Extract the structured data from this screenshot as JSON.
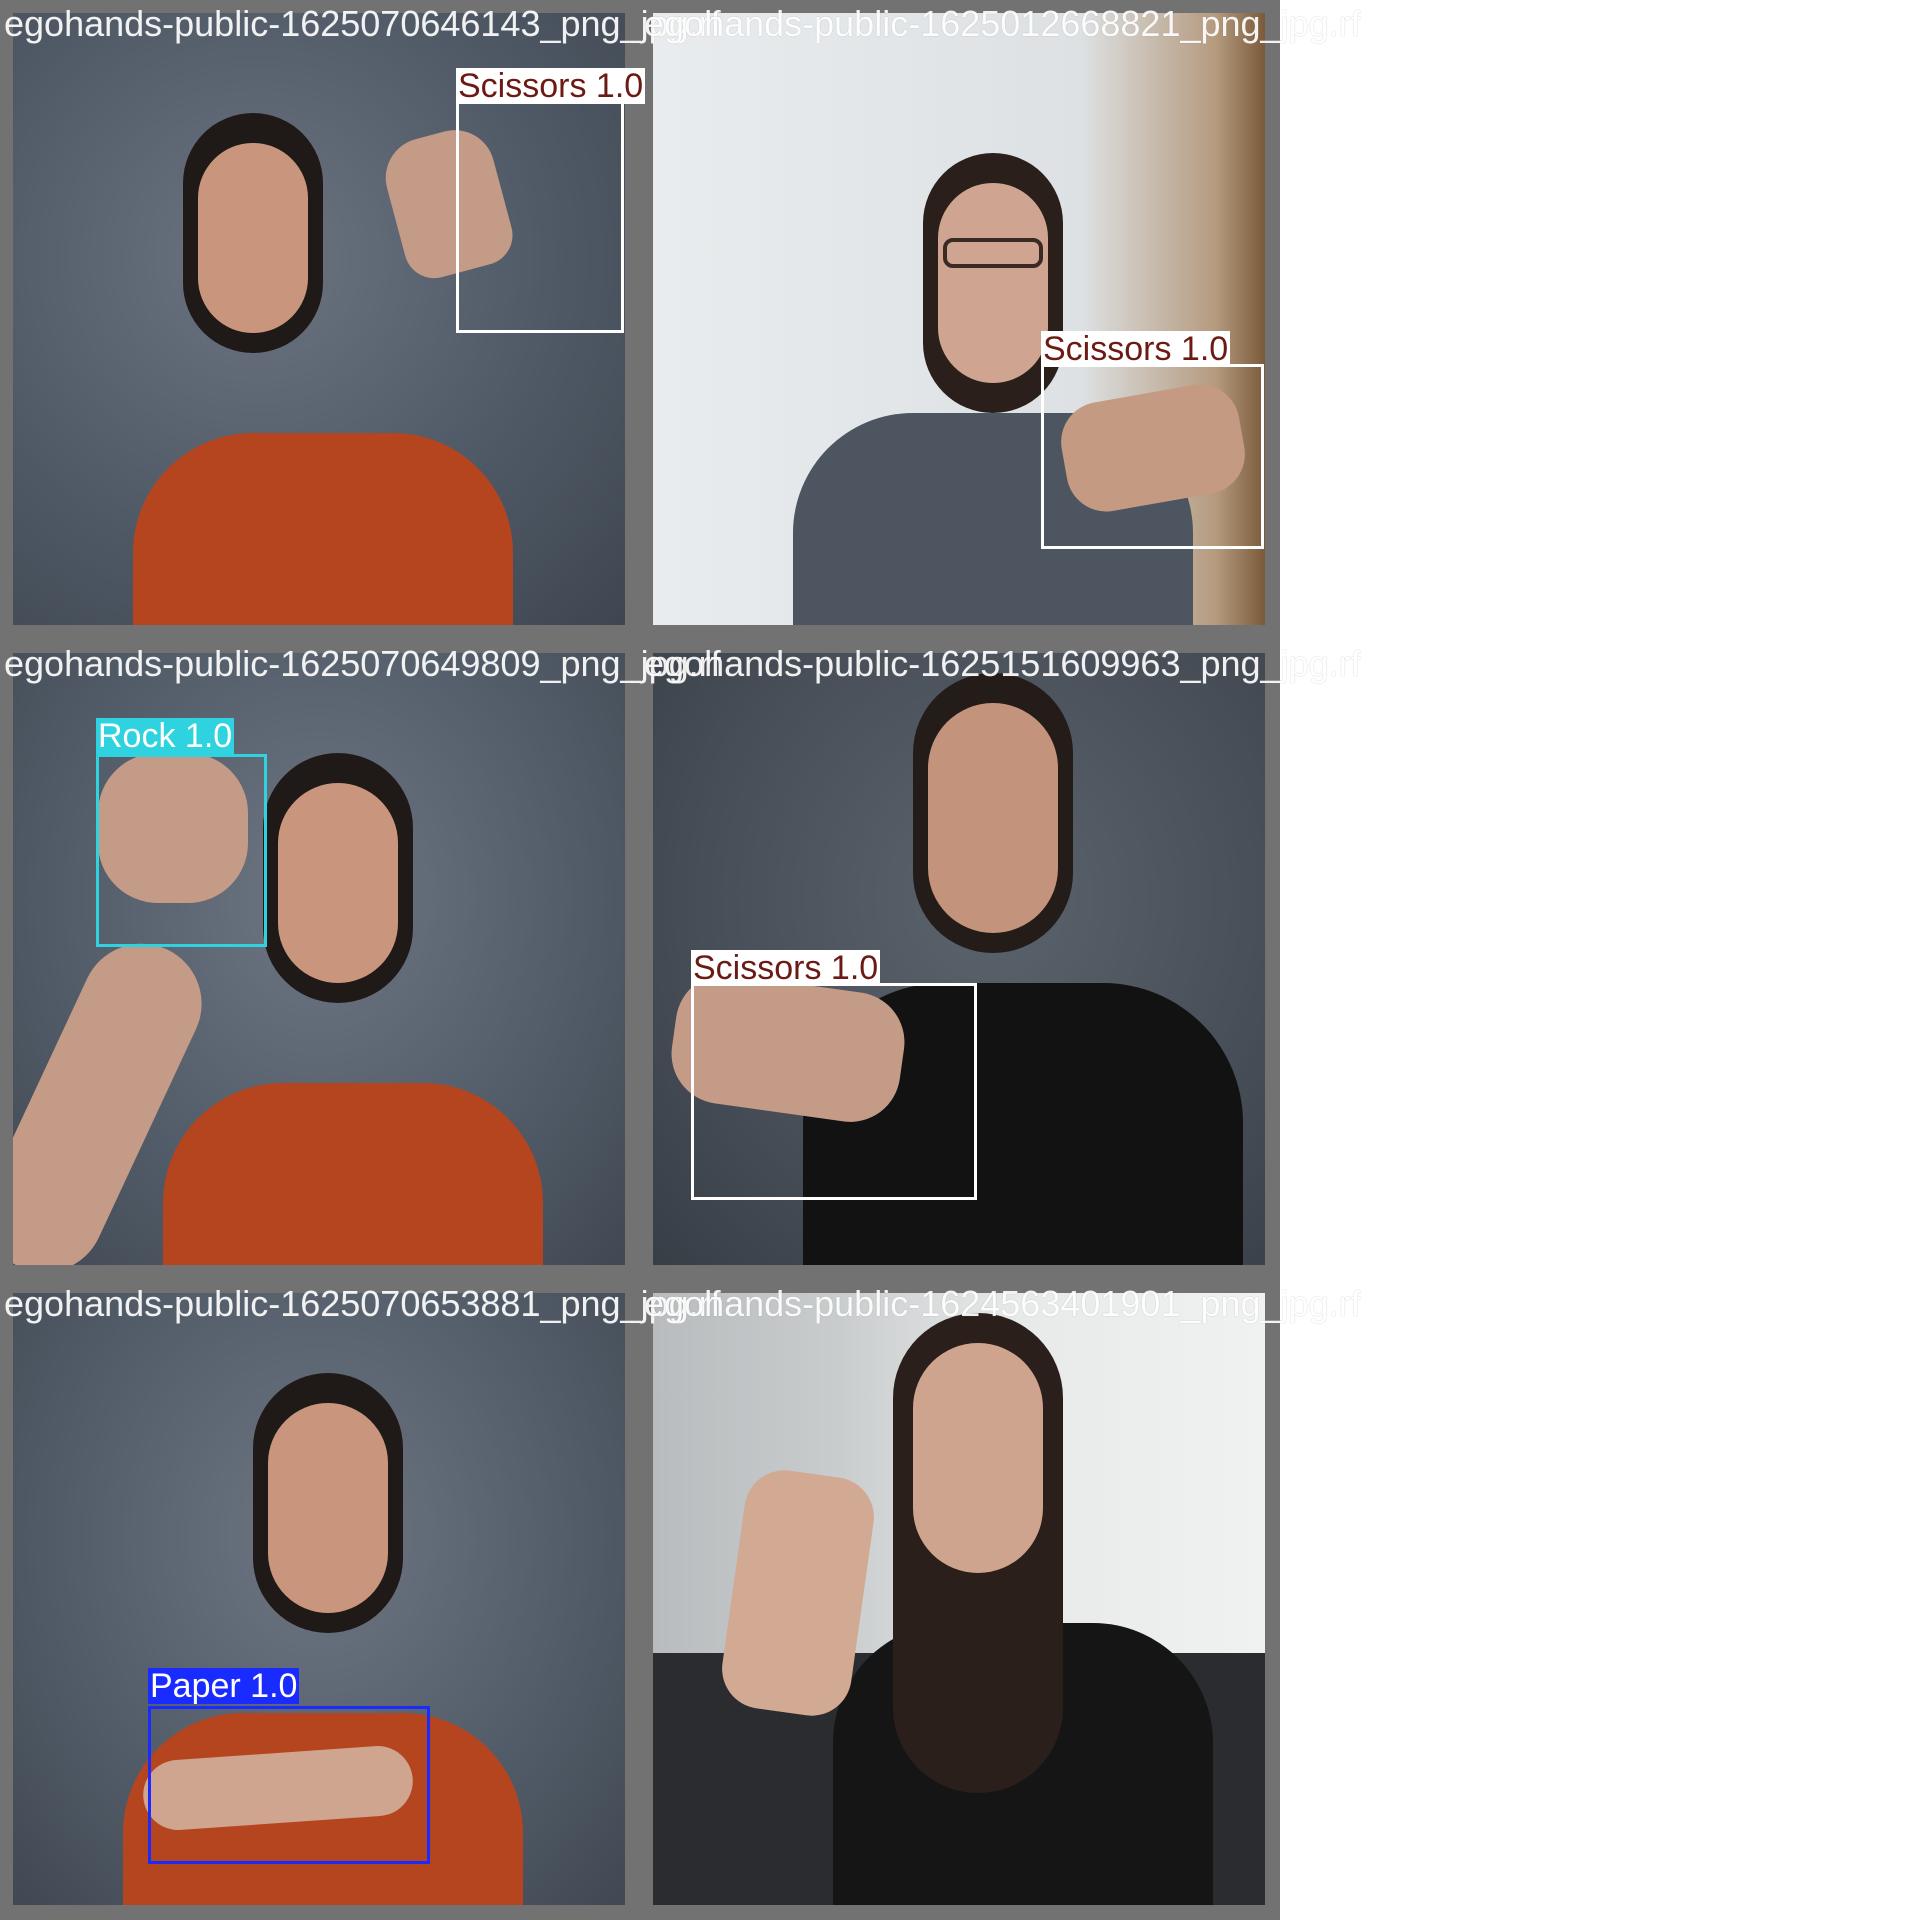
{
  "tiles": [
    {
      "filename": "egohands-public-1625070646143_png_jpg.rf",
      "detections": [
        {
          "label": "Scissors 1.0",
          "class": "Scissors"
        }
      ]
    },
    {
      "filename": "egohands-public-1625012668821_png_jpg.rf",
      "detections": [
        {
          "label": "Scissors 1.0",
          "class": "Scissors"
        }
      ]
    },
    {
      "filename": "egohands-public-1625070649809_png_jpg.rf",
      "detections": [
        {
          "label": "Rock 1.0",
          "class": "Rock"
        }
      ]
    },
    {
      "filename": "egohands-public-1625151609963_png_jpg.rf",
      "detections": [
        {
          "label": "Scissors 1.0",
          "class": "Scissors"
        }
      ]
    },
    {
      "filename": "egohands-public-1625070653881_png_jpg.rf",
      "detections": [
        {
          "label": "Paper 1.0",
          "class": "Paper"
        }
      ]
    },
    {
      "filename": "egohands-public-1624563401901_png_jpg.rf",
      "detections": []
    }
  ],
  "class_colors": {
    "Scissors": {
      "box": "#ffffff",
      "label_bg": "#ffffff",
      "label_text": "#6b1a14"
    },
    "Rock": {
      "box": "#2fd3e0",
      "label_bg": "#2fd3e0",
      "label_text": "#ffffff"
    },
    "Paper": {
      "box": "#1a2bff",
      "label_bg": "#1a2bff",
      "label_text": "#ffffff"
    }
  },
  "scene_icons": [
    "person",
    "hand-gesture"
  ]
}
